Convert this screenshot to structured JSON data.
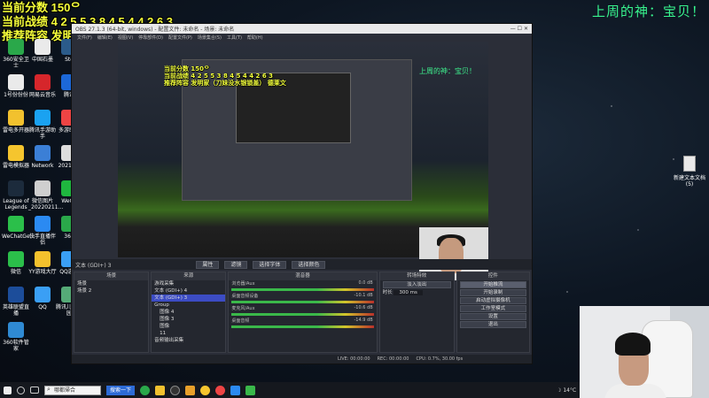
{
  "overlay": {
    "score_line": "当前分数 150ᄋ",
    "record_line": "当前战绩  4 2 5 5 3 8 4 5 4 4 2 6 3",
    "recommend_line": "推荐阵容 发明家（刀妹没水银锁盖） 德莱文",
    "god_line": "上周的神：宝贝！"
  },
  "desktop_icons": [
    {
      "label": "360安全卫士",
      "color": "#2aa84a"
    },
    {
      "label": "中国石墨",
      "color": "#eaeaea"
    },
    {
      "label": "Ste",
      "color": "#2b5b8a"
    },
    {
      "label": "1号份份份",
      "color": "#eaeaea"
    },
    {
      "label": "网易云音乐",
      "color": "#d6262b"
    },
    {
      "label": "腾讯",
      "color": "#1c68d8"
    },
    {
      "label": "雷电多开器",
      "color": "#f2c12e"
    },
    {
      "label": "腾讯手游助手",
      "color": "#1aa2f1"
    },
    {
      "label": "多游助手",
      "color": "#e44"
    },
    {
      "label": "雷电模拟器",
      "color": "#f5c52e"
    },
    {
      "label": "Network",
      "color": "#3b7fd6"
    },
    {
      "label": "20211...",
      "color": "#ddd"
    },
    {
      "label": "League of Legends",
      "color": "#1c2b3c"
    },
    {
      "label": "微信图片_20220211...",
      "color": "#cfcfcf"
    },
    {
      "label": "WeGa",
      "color": "#1fb63f"
    },
    {
      "label": "WeChatGe...",
      "color": "#2bbf4a"
    },
    {
      "label": "快手直播伴侣",
      "color": "#2b8af2"
    },
    {
      "label": "360",
      "color": "#2aa84a"
    },
    {
      "label": "微信",
      "color": "#2bbf4a"
    },
    {
      "label": "YY游戏大厅",
      "color": "#f4c12d"
    },
    {
      "label": "QQ游戏",
      "color": "#3a9ff5"
    },
    {
      "label": "英雄联盟直播",
      "color": "#1c4d9a"
    },
    {
      "label": "QQ",
      "color": "#3a9ff5"
    },
    {
      "label": "腾讯儿童乐园",
      "color": "#5a7"
    },
    {
      "label": "360软件管家",
      "color": "#2f8ad3"
    }
  ],
  "right_desktop_icon": {
    "label": "新建文本文档 (5)"
  },
  "obs": {
    "title": "OBS 27.1.3 (64-bit, windows) - 配置文件: 未命名 - 场景: 未命名",
    "menu": [
      "文件(F)",
      "编辑(E)",
      "视图(V)",
      "停靠部件(D)",
      "配置文件(P)",
      "场景集合(S)",
      "工具(T)",
      "帮助(H)"
    ],
    "selected_source_label": "文本 (GDI+) 3",
    "strip_buttons": [
      "属性",
      "滤镜",
      "选择字体",
      "选择颜色"
    ],
    "docks": {
      "scenes_header": "场景",
      "scenes": [
        "场景",
        "场景 2"
      ],
      "sources_header": "来源",
      "sources": [
        "游戏采集",
        "文本 (GDI+) 4",
        "文本 (GDI+) 3",
        "Group",
        "图像 4",
        "图像 3",
        "图像",
        "11",
        "音频输出采集"
      ],
      "mixer_header": "混音器",
      "mixer": [
        {
          "name": "浏览器/Aux",
          "db": "0.0 dB"
        },
        {
          "name": "桌面音频设备",
          "db": "-10.1 dB"
        },
        {
          "name": "麦克风/Aux",
          "db": "-10.6 dB"
        },
        {
          "name": "桌面音频",
          "db": "-14.9 dB"
        }
      ],
      "transitions_header": "转场特效",
      "transition_name": "淡入淡出",
      "duration_label": "时长",
      "duration_value": "300 ms",
      "controls_header": "控件",
      "controls": [
        "开始推流",
        "开始录制",
        "启动虚拟摄像机",
        "工作室模式",
        "设置",
        "退出"
      ]
    },
    "status": [
      "LIVE: 00:00:00",
      "REC: 00:00:00",
      "CPU: 0.7%, 30.00 fps"
    ]
  },
  "taskbar": {
    "search_text": "哪都帰合",
    "search_button": "搜索一下",
    "weather": "14°C"
  }
}
